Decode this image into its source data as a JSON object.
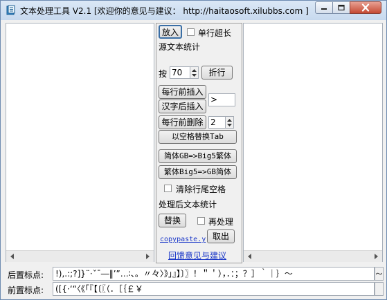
{
  "window": {
    "title": "文本处理工具 V2.1 [欢迎你的意见与建议： http://haitaosoft.xilubbs.com ]"
  },
  "panel": {
    "enlarge_label": "放入",
    "single_line_label": "单行超长",
    "source_stats_label": "源文本统计",
    "per_label": "按",
    "wrap_value": "70",
    "wrap_label": "折行",
    "insert_before_label": "每行前插入",
    "insert_after_han_label": "汉字后插入",
    "insert_value": ">",
    "delete_before_label": "每行前删除",
    "delete_value": "2",
    "space_to_tab_label": "以空格替换Tab",
    "gb_to_big5_label": "简体GB=>Big5繁体",
    "big5_to_gb_label": "繁体Big5=>GB简体",
    "trim_trailing_label": "清除行尾空格",
    "processed_stats_label": "处理后文本统计",
    "replace_label": "替换",
    "reprocess_label": "再处理",
    "copypaste_label": "copypaste.y",
    "take_out_label": "取出",
    "feedback_label": "回馈意见与建议"
  },
  "bottom": {
    "post_punct_label": "后置标点:",
    "post_punct_value": "!),.:;?]}¨·ˇˉ―‖’”…∶、。〃々〉》」』】〕〗！＂＇），．：；？］｀｜｝～",
    "pre_punct_label": "前置标点:",
    "pre_punct_value": "([{·‘“〈《「『【〔〖（．［｛￡￥"
  }
}
